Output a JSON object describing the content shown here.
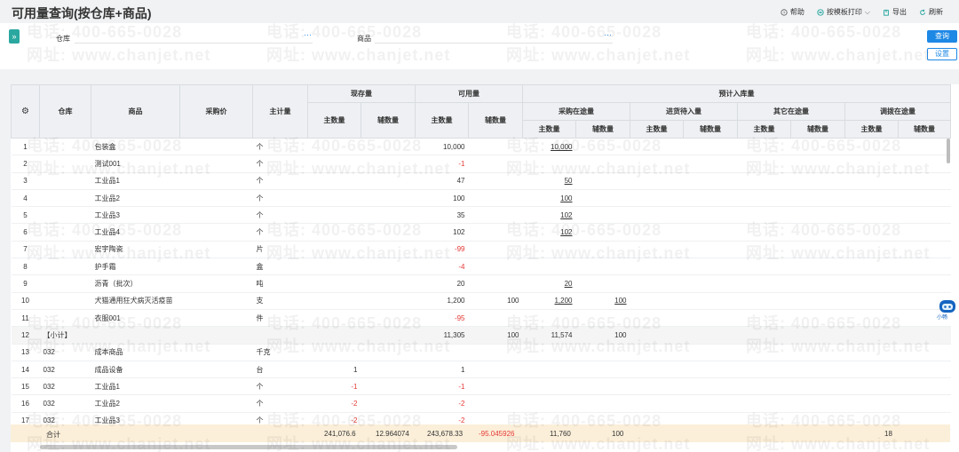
{
  "title": "可用量查询(按仓库+商品)",
  "header_actions": [
    {
      "label": "帮助",
      "icon": "help-icon"
    },
    {
      "label": "按模板打印",
      "icon": "print-icon"
    },
    {
      "label": "导出",
      "icon": "export-icon"
    },
    {
      "label": "刷新",
      "icon": "refresh-icon"
    }
  ],
  "filters": {
    "warehouse_label": "仓库",
    "product_label": "商品",
    "dots": "···"
  },
  "buttons": {
    "query": "查询",
    "settings": "设置"
  },
  "columns": {
    "warehouse": "仓库",
    "product": "商品",
    "purchase_price": "采购价",
    "main_unit": "主计量",
    "on_hand": "现存量",
    "available": "可用量",
    "expected_in": "预计入库量",
    "main_qty": "主数量",
    "aux_qty": "辅数量",
    "purchase_transit": "采购在途量",
    "pending_in": "进货待入量",
    "other_transit": "其它在途量",
    "transfer_transit": "调拨在途量"
  },
  "rows": [
    {
      "no": "1",
      "wh": "",
      "prod": "包装盒",
      "unit": "个",
      "oh": "",
      "avail": "10,000",
      "availAux": "",
      "pt": "10,000",
      "ptAux": ""
    },
    {
      "no": "2",
      "wh": "",
      "prod": "测试001",
      "unit": "个",
      "oh": "",
      "avail": "-1",
      "availAux": "",
      "pt": "",
      "ptAux": ""
    },
    {
      "no": "3",
      "wh": "",
      "prod": "工业品1",
      "unit": "个",
      "oh": "",
      "avail": "47",
      "availAux": "",
      "pt": "50",
      "ptAux": ""
    },
    {
      "no": "4",
      "wh": "",
      "prod": "工业品2",
      "unit": "个",
      "oh": "",
      "avail": "100",
      "availAux": "",
      "pt": "100",
      "ptAux": ""
    },
    {
      "no": "5",
      "wh": "",
      "prod": "工业品3",
      "unit": "个",
      "oh": "",
      "avail": "35",
      "availAux": "",
      "pt": "102",
      "ptAux": ""
    },
    {
      "no": "6",
      "wh": "",
      "prod": "工业品4",
      "unit": "个",
      "oh": "",
      "avail": "102",
      "availAux": "",
      "pt": "102",
      "ptAux": ""
    },
    {
      "no": "7",
      "wh": "",
      "prod": "宏宇陶瓷",
      "unit": "片",
      "oh": "",
      "avail": "-99",
      "availAux": "",
      "pt": "",
      "ptAux": ""
    },
    {
      "no": "8",
      "wh": "",
      "prod": "护手霜",
      "unit": "盒",
      "oh": "",
      "avail": "-4",
      "availAux": "",
      "pt": "",
      "ptAux": ""
    },
    {
      "no": "9",
      "wh": "",
      "prod": "沥青（批次）",
      "unit": "吨",
      "oh": "",
      "avail": "20",
      "availAux": "",
      "pt": "20",
      "ptAux": ""
    },
    {
      "no": "10",
      "wh": "",
      "prod": "犬猫通用狂犬病灭活疫苗",
      "unit": "支",
      "oh": "",
      "avail": "1,200",
      "availAux": "100",
      "pt": "1,200",
      "ptAux": "100"
    },
    {
      "no": "11",
      "wh": "",
      "prod": "衣服001",
      "unit": "件",
      "oh": "",
      "avail": "-95",
      "availAux": "",
      "pt": "",
      "ptAux": ""
    },
    {
      "no": "12",
      "wh": "【小计】",
      "prod": "",
      "unit": "",
      "oh": "",
      "avail": "11,305",
      "availAux": "100",
      "pt": "11,574",
      "ptAux": "100"
    },
    {
      "no": "13",
      "wh": "032",
      "prod": "成本商品",
      "unit": "千克",
      "oh": "",
      "avail": "",
      "availAux": "",
      "pt": "",
      "ptAux": ""
    },
    {
      "no": "14",
      "wh": "032",
      "prod": "成品设备",
      "unit": "台",
      "oh": "1",
      "avail": "1",
      "availAux": "",
      "pt": "",
      "ptAux": ""
    },
    {
      "no": "15",
      "wh": "032",
      "prod": "工业品1",
      "unit": "个",
      "oh": "-1",
      "avail": "-1",
      "availAux": "",
      "pt": "",
      "ptAux": ""
    },
    {
      "no": "16",
      "wh": "032",
      "prod": "工业品2",
      "unit": "个",
      "oh": "-2",
      "avail": "-2",
      "availAux": "",
      "pt": "",
      "ptAux": ""
    },
    {
      "no": "17",
      "wh": "032",
      "prod": "工业品3",
      "unit": "个",
      "oh": "-2",
      "avail": "-2",
      "availAux": "",
      "pt": "",
      "ptAux": ""
    }
  ],
  "totals": {
    "label": "合计",
    "on_hand_main": "241,076.6",
    "on_hand_aux": "12.964074",
    "avail_main": "243,678.33",
    "avail_aux": "-95.045926",
    "pt_main": "11,760",
    "pt_aux": "100",
    "transfer_main": "18"
  },
  "assistant_label": "小畅",
  "watermark": {
    "phone": "电话: 400-665-0028",
    "site": "网址: www.chanjet.net"
  }
}
